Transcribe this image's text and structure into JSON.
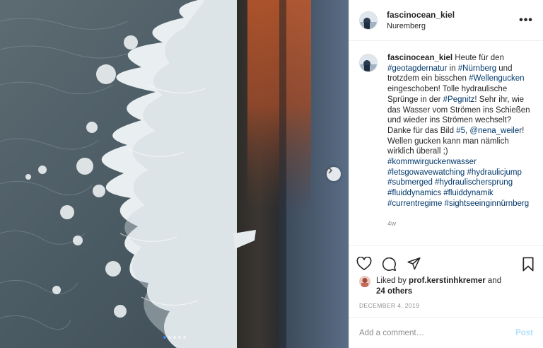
{
  "post": {
    "username": "fascinocean_kiel",
    "location": "Nuremberg",
    "caption": {
      "username": "fascinocean_kiel",
      "segments": [
        {
          "t": " Heute für den "
        },
        {
          "t": "#geotagdernatur",
          "tag": true
        },
        {
          "t": " in "
        },
        {
          "t": "#Nürnberg",
          "tag": true
        },
        {
          "t": " und trotzdem ein bisschen "
        },
        {
          "t": "#Wellengucken",
          "tag": true
        },
        {
          "t": " eingeschoben! Tolle hydraulische Sprünge in der "
        },
        {
          "t": "#Pegnitz",
          "tag": true
        },
        {
          "t": "! Sehr ihr, wie das Wasser vom Strömen ins Schießen und wieder ins Strömen wechselt? Danke für das Bild "
        },
        {
          "t": "#5",
          "tag": true
        },
        {
          "t": ", "
        },
        {
          "t": "@nena_weiler",
          "tag": true
        },
        {
          "t": "! Wellen gucken kann man nämlich wirklich überall ;) "
        },
        {
          "t": "#kommwirguckenwasser",
          "tag": true
        },
        {
          "t": " "
        },
        {
          "t": "#letsgowavewatching",
          "tag": true
        },
        {
          "t": " "
        },
        {
          "t": "#hydraulicjump",
          "tag": true
        },
        {
          "t": " "
        },
        {
          "t": "#submerged",
          "tag": true
        },
        {
          "t": " "
        },
        {
          "t": "#hydraulischersprung",
          "tag": true
        },
        {
          "t": " "
        },
        {
          "t": "#fluiddynamics",
          "tag": true
        },
        {
          "t": " "
        },
        {
          "t": "#fluiddynamik",
          "tag": true
        },
        {
          "t": " "
        },
        {
          "t": "#currentregime",
          "tag": true
        },
        {
          "t": " "
        },
        {
          "t": "#sightseeinginnürnberg",
          "tag": true
        }
      ]
    },
    "time_ago": "4w",
    "liked_by_prefix": "Liked by",
    "liked_by_user": "prof.kerstinhkremer",
    "liked_by_and": "and",
    "others": "24 others",
    "date": "DECEMBER 4, 2019",
    "comment_placeholder": "Add a comment…",
    "post_label": "Post",
    "carousel": {
      "count": 5,
      "active_index": 0
    }
  },
  "icons": {
    "more": "more-options-icon",
    "like": "heart-icon",
    "comment": "comment-icon",
    "share": "share-icon",
    "save": "bookmark-icon",
    "next": "chevron-right-icon"
  },
  "colors": {
    "hashtag": "#00376b",
    "post_button_disabled": "#b2dffc",
    "muted": "#8e8e8e",
    "carousel_active": "#2f8ae6"
  }
}
